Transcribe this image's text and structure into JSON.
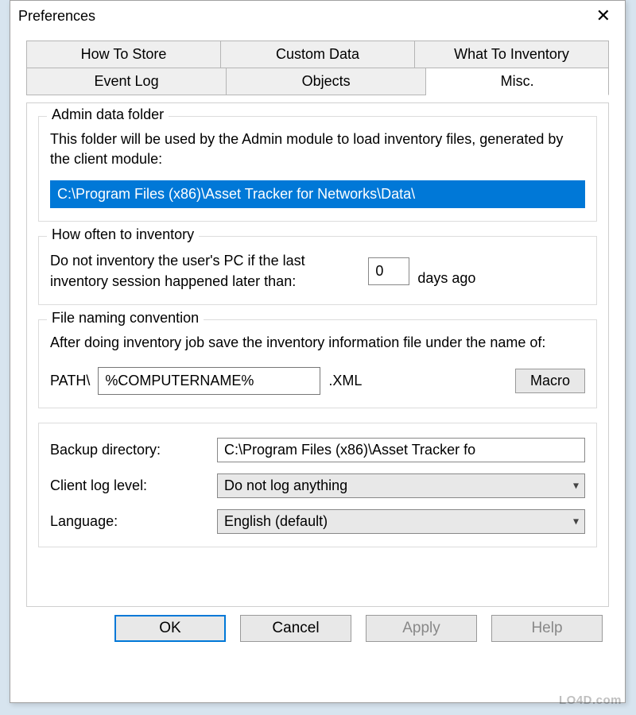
{
  "window": {
    "title": "Preferences"
  },
  "tabs_row1": {
    "how_to_store": "How To Store",
    "custom_data": "Custom Data",
    "what_to_inventory": "What To Inventory"
  },
  "tabs_row2": {
    "event_log": "Event Log",
    "objects": "Objects",
    "misc": "Misc."
  },
  "admin": {
    "legend": "Admin data folder",
    "desc": "This folder will be used by the Admin module to load inventory files, generated by the client module:",
    "path": "C:\\Program Files (x86)\\Asset Tracker for Networks\\Data\\"
  },
  "how_often": {
    "legend": "How often to inventory",
    "desc": "Do not inventory the user's PC if the last inventory session happened later than:",
    "value": "0",
    "suffix": "days ago"
  },
  "file_naming": {
    "legend": "File naming convention",
    "desc": "After doing inventory job save the inventory information file under the name of:",
    "path_label": "PATH\\",
    "value": "%COMPUTERNAME%",
    "ext": ".XML",
    "macro": "Macro"
  },
  "bottom": {
    "backup_label": "Backup directory:",
    "backup_value": "C:\\Program Files (x86)\\Asset Tracker fo",
    "log_label": "Client log level:",
    "log_value": "Do not log anything",
    "lang_label": "Language:",
    "lang_value": "English (default)"
  },
  "buttons": {
    "ok": "OK",
    "cancel": "Cancel",
    "apply": "Apply",
    "help": "Help"
  },
  "watermark": "LO4D.com"
}
